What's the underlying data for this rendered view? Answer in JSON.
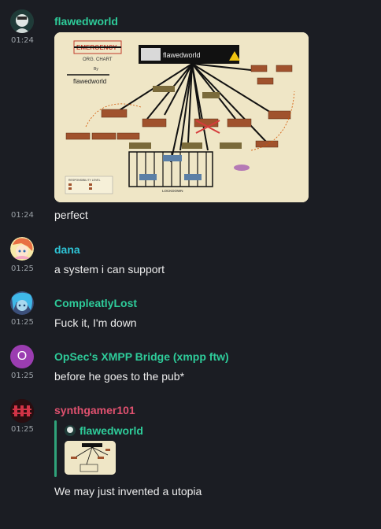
{
  "messages": [
    {
      "author": "flawedworld",
      "time": "01:24",
      "author_color": "#2ecc9a",
      "image": {
        "title_redacted": "EMERGENCY",
        "chart_title": "ORG. CHART",
        "byline": "By",
        "byline_name": "flawedworld",
        "top_box": "flawedworld",
        "label_lockdown": "LOCKDOWN",
        "label_legend": "RESPONSIBILITY LEVEL"
      }
    },
    {
      "time": "01:24",
      "text": "perfect"
    },
    {
      "author": "dana",
      "time": "01:25",
      "author_color": "#2ec4d6",
      "text": "a system i can support"
    },
    {
      "author": "CompleatlyLost",
      "time": "01:25",
      "author_color": "#2ecc9a",
      "text": "Fuck it, I'm down"
    },
    {
      "author": "OpSec's XMPP Bridge (xmpp ftw)",
      "time": "01:25",
      "author_color": "#2ecc9a",
      "avatar_letter": "O",
      "avatar_color": "#9b3db1",
      "text": "before he goes to the pub*"
    },
    {
      "author": "synthgamer101",
      "time": "01:25",
      "author_color": "#e0516f",
      "reply": {
        "author": "flawedworld",
        "author_color": "#2ecc9a"
      },
      "text": "We may just invented a utopia"
    }
  ]
}
